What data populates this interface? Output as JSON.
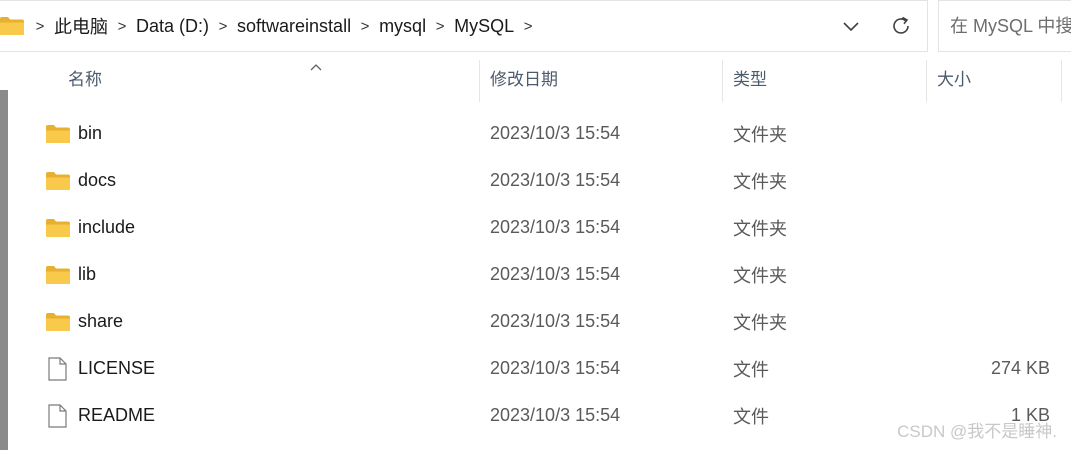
{
  "address_bar": {
    "breadcrumbs": [
      "此电脑",
      "Data (D:)",
      "softwareinstall",
      "mysql",
      "MySQL"
    ],
    "separator": ">",
    "trailing_separator": ">"
  },
  "search": {
    "placeholder": "在 MySQL 中搜"
  },
  "columns": {
    "name": "名称",
    "date": "修改日期",
    "type": "类型",
    "size": "大小"
  },
  "files": [
    {
      "name": "bin",
      "date": "2023/10/3 15:54",
      "type": "文件夹",
      "size": "",
      "icon": "folder-icon"
    },
    {
      "name": "docs",
      "date": "2023/10/3 15:54",
      "type": "文件夹",
      "size": "",
      "icon": "folder-icon"
    },
    {
      "name": "include",
      "date": "2023/10/3 15:54",
      "type": "文件夹",
      "size": "",
      "icon": "folder-icon"
    },
    {
      "name": "lib",
      "date": "2023/10/3 15:54",
      "type": "文件夹",
      "size": "",
      "icon": "folder-icon"
    },
    {
      "name": "share",
      "date": "2023/10/3 15:54",
      "type": "文件夹",
      "size": "",
      "icon": "folder-icon"
    },
    {
      "name": "LICENSE",
      "date": "2023/10/3 15:54",
      "type": "文件",
      "size": "274 KB",
      "icon": "file-icon"
    },
    {
      "name": "README",
      "date": "2023/10/3 15:54",
      "type": "文件",
      "size": "1 KB",
      "icon": "file-icon"
    }
  ],
  "watermark": "CSDN @我不是睡神.",
  "colors": {
    "folder": "#f8c94a",
    "folder_dark": "#e8b030",
    "header_text": "#4c5a6d",
    "secondary_text": "#5a5a5a"
  }
}
